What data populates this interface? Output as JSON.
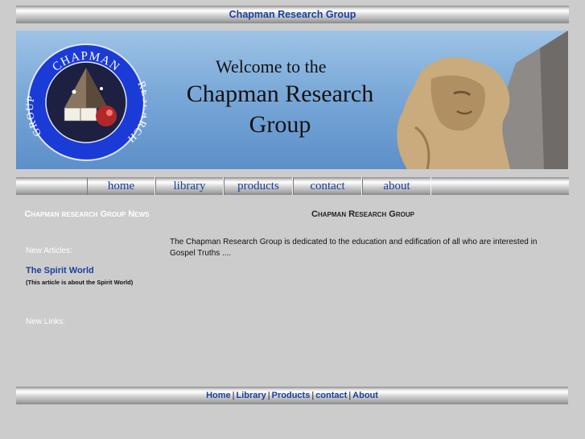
{
  "header": {
    "title": "Chapman Research Group"
  },
  "banner": {
    "welcome": "Welcome to the",
    "title": "Chapman Research Group",
    "seal_text_top": "CHAPMAN",
    "seal_text_right": "RESEARCH",
    "seal_text_left": "GROUP"
  },
  "nav": [
    {
      "label": "home"
    },
    {
      "label": "library"
    },
    {
      "label": "products"
    },
    {
      "label": "contact"
    },
    {
      "label": "about"
    }
  ],
  "sidebar": {
    "title": "Chapman research Group News",
    "new_articles_label": "New Articles:",
    "article": {
      "title": "The Spirit World",
      "desc": "(This article is about the Spirit World)"
    },
    "new_links_label": "New Links:"
  },
  "main": {
    "heading": "Chapman Research Group",
    "text": "The Chapman Research Group is dedicated to the education and edification of all who are interested in Gospel Truths ...."
  },
  "footer": {
    "links": [
      "Home",
      "Library",
      "Products",
      "contact",
      "About"
    ],
    "separator": "|"
  },
  "colors": {
    "link": "#1a3f9e",
    "background": "#cccccc",
    "banner_sky": "#7aa9d8"
  }
}
